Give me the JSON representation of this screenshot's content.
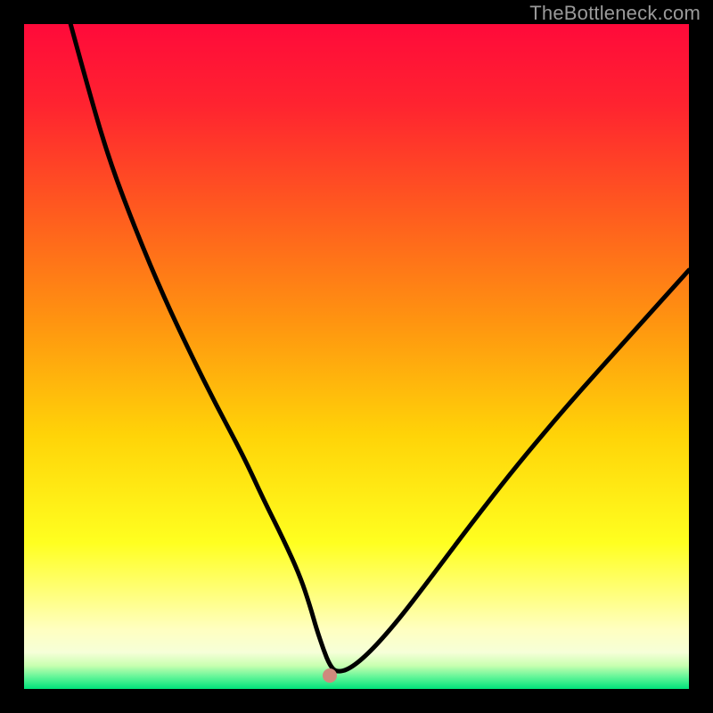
{
  "watermark": "TheBottleneck.com",
  "gradient_stops": [
    {
      "offset": 0.0,
      "color": "#ff0a3a"
    },
    {
      "offset": 0.12,
      "color": "#ff2330"
    },
    {
      "offset": 0.28,
      "color": "#ff5a1f"
    },
    {
      "offset": 0.45,
      "color": "#ff9510"
    },
    {
      "offset": 0.62,
      "color": "#ffd408"
    },
    {
      "offset": 0.78,
      "color": "#ffff20"
    },
    {
      "offset": 0.86,
      "color": "#ffff80"
    },
    {
      "offset": 0.91,
      "color": "#ffffc0"
    },
    {
      "offset": 0.945,
      "color": "#f6ffd8"
    },
    {
      "offset": 0.965,
      "color": "#c8ffb0"
    },
    {
      "offset": 0.982,
      "color": "#62f598"
    },
    {
      "offset": 1.0,
      "color": "#00e27a"
    }
  ],
  "chart_data": {
    "type": "line",
    "title": "",
    "xlabel": "",
    "ylabel": "",
    "xlim": [
      0,
      100
    ],
    "ylim": [
      0,
      100
    ],
    "marker": {
      "x": 46,
      "y": 2
    },
    "series": [
      {
        "name": "curve",
        "x": [
          7,
          10,
          13,
          17,
          21,
          25,
          29,
          33,
          36,
          39,
          41.5,
          43,
          44,
          45,
          46,
          47,
          49,
          52,
          56,
          61,
          67,
          74,
          82,
          91,
          100
        ],
        "y": [
          100,
          89,
          79,
          68.5,
          59,
          50.5,
          42.5,
          35,
          28.5,
          22.5,
          17,
          12.5,
          9,
          6,
          3.5,
          2.5,
          3,
          5.5,
          10,
          16.5,
          24.5,
          33.5,
          43,
          53,
          63
        ]
      }
    ],
    "notes": "x/y are percent of plot area; y=0 is bottom, y=100 is top; values estimated visually"
  }
}
